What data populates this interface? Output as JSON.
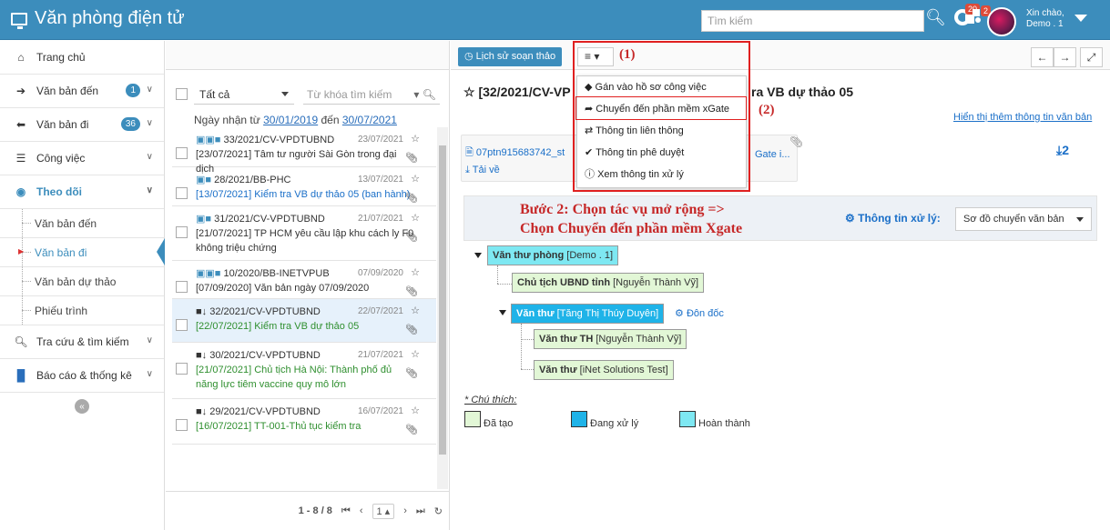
{
  "app": {
    "title": "Văn phòng điện tử"
  },
  "header": {
    "search_placeholder": "Tìm kiếm",
    "notif_badge": "20",
    "plugin_badge": "2",
    "greeting": "Xin chào,",
    "username": "Demo . 1"
  },
  "sidebar": {
    "items": [
      {
        "label": "Trang chủ"
      },
      {
        "label": "Văn bản đến",
        "badge": "1"
      },
      {
        "label": "Văn bản đi",
        "badge": "36"
      },
      {
        "label": "Công việc"
      },
      {
        "label": "Theo dõi"
      },
      {
        "label": "Tra cứu & tìm kiếm"
      },
      {
        "label": "Báo cáo & thống kê"
      }
    ],
    "sub": [
      "Văn bản đến",
      "Văn bản đi",
      "Văn bản dự thảo",
      "Phiếu trình"
    ]
  },
  "filter": {
    "select_value": "Tất cả",
    "keyword_placeholder": "Từ khóa tìm kiếm",
    "date_prefix": "Ngày nhận từ",
    "date_from": "30/01/2019",
    "date_mid": "đến",
    "date_to": "30/07/2021"
  },
  "docs": [
    {
      "num": "33/2021/CV-VPDTUBND",
      "date": "23/07/2021",
      "title": "[23/07/2021] Tâm tư người Sài Gòn trong đại dịch"
    },
    {
      "num": "28/2021/BB-PHC",
      "date": "13/07/2021",
      "title": "[13/07/2021] Kiểm tra VB dự thảo 05 (ban hành)"
    },
    {
      "num": "31/2021/CV-VPDTUBND",
      "date": "21/07/2021",
      "title": "[21/07/2021] TP HCM yêu cầu lập khu cách ly F0 không triệu chứng"
    },
    {
      "num": "10/2020/BB-INETVPUB",
      "date": "07/09/2020",
      "title": "[07/09/2020] Văn bản ngày 07/09/2020"
    },
    {
      "num": "32/2021/CV-VPDTUBND",
      "date": "22/07/2021",
      "title": "[22/07/2021] Kiểm tra VB dự thảo 05"
    },
    {
      "num": "30/2021/CV-VPDTUBND",
      "date": "21/07/2021",
      "title": "[21/07/2021] Chủ tịch Hà Nội: Thành phố đủ năng lực tiêm vaccine quy mô lớn"
    },
    {
      "num": "29/2021/CV-VPDTUBND",
      "date": "16/07/2021",
      "title": "[16/07/2021] TT-001-Thủ tục kiểm tra"
    }
  ],
  "pager": {
    "range": "1 - 8 / 8",
    "page": "1"
  },
  "toolbar": {
    "history_btn": "Lịch sử soạn thảo",
    "menu_btn": "≡"
  },
  "annotations": {
    "a1": "(1)",
    "a2": "(2)",
    "step_line1": "Bước 2: Chọn tác vụ mở rộng =>",
    "step_line2": "Chọn Chuyển đến phần mềm Xgate"
  },
  "doc": {
    "title_left": "☆ [32/2021/CV-VP",
    "title_right": "ra VB dự thảo 05",
    "more_info": "Hiển thị thêm thông tin văn bản",
    "file_name": "07ptn915683742_st",
    "file_gate": "Gate i...",
    "download": "Tải về",
    "attach_count": "2"
  },
  "dropdown": [
    "Gán vào hồ sơ công việc",
    "Chuyển đến phần mềm xGate",
    "Thông tin liên thông",
    "Thông tin phê duyệt",
    "Xem thông tin xử lý"
  ],
  "process": {
    "info_label": "Thông tin xử lý:",
    "view_select": "Sơ đồ chuyển văn bản",
    "nodes": [
      {
        "role": "Văn thư phòng",
        "person": "[Demo . 1]"
      },
      {
        "role": "Chủ tịch UBND tỉnh",
        "person": "[Nguyễn Thành Vỹ]"
      },
      {
        "role": "Văn thư",
        "person": "[Tăng Thị Thúy Duyên]"
      },
      {
        "role": "Văn thư TH",
        "person": "[Nguyễn Thành Vỹ]"
      },
      {
        "role": "Văn thư",
        "person": "[iNet Solutions Test]"
      }
    ],
    "urge": "Đôn đốc",
    "legend_title": "* Chú thích:",
    "legend": [
      "Đã tạo",
      "Đang xử lý",
      "Hoàn thành"
    ]
  }
}
